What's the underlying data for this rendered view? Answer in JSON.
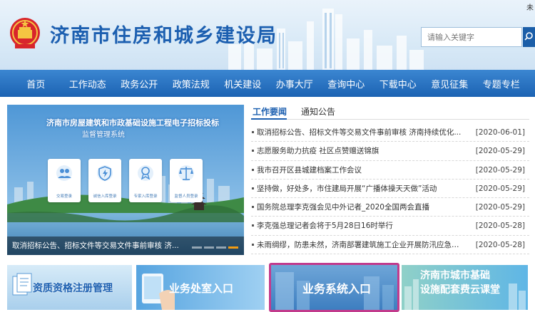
{
  "header": {
    "site_title": "济南市住房和城乡建设局",
    "corner_text": "未",
    "search_placeholder": "请输入关键字",
    "search_icon": "search-icon",
    "colors": {
      "brand_blue": "#1c5fb0",
      "nav_blue": "#2a73c2",
      "highlight_magenta": "#c23b8d"
    }
  },
  "nav": {
    "items": [
      {
        "label": "首页"
      },
      {
        "label": "工作动态"
      },
      {
        "label": "政务公开"
      },
      {
        "label": "政策法规"
      },
      {
        "label": "机关建设"
      },
      {
        "label": "办事大厅"
      },
      {
        "label": "查询中心"
      },
      {
        "label": "下载中心"
      },
      {
        "label": "意见征集"
      },
      {
        "label": "专题专栏"
      }
    ]
  },
  "banner": {
    "title": "济南市房屋建筑和市政基础设施工程电子招标投标",
    "subtitle": "监督管理系统",
    "tiles": [
      {
        "icon": "users-icon",
        "label": "交易登录"
      },
      {
        "icon": "shield-icon",
        "label": "诚信入库登录"
      },
      {
        "icon": "certificate-icon",
        "label": "专家入库登录"
      },
      {
        "icon": "balance-scale-icon",
        "label": "监督人员登录"
      }
    ],
    "caption": "取消招标公告、招标文件等交易文件事前审核 济...",
    "active_slide": 4,
    "slide_count": 4
  },
  "news": {
    "tabs": [
      {
        "label": "工作要闻",
        "active": true
      },
      {
        "label": "通知公告",
        "active": false
      }
    ],
    "items": [
      {
        "title": "取消招标公告、招标文件等交易文件事前审核 济南持续优化...",
        "date": "[2020-06-01]"
      },
      {
        "title": "志愿服务助力抗疫 社区点赞赠送锦旗",
        "date": "[2020-05-29]"
      },
      {
        "title": "我市召开区县城建档案工作会议",
        "date": "[2020-05-29]"
      },
      {
        "title": "坚持做，好处多，市住建局开展“广播体操天天做”活动",
        "date": "[2020-05-29]"
      },
      {
        "title": "国务院总理李克强会见中外记者_2020全国两会直播",
        "date": "[2020-05-29]"
      },
      {
        "title": "李克强总理记者会将于5月28日16时举行",
        "date": "[2020-05-28]"
      },
      {
        "title": "未雨绸缪，防患未然，济南部署建筑施工企业开展防汛应急演...",
        "date": "[2020-05-28]"
      }
    ]
  },
  "quick_links": [
    {
      "label": "资质资格注册管理"
    },
    {
      "label": "业务处室入口"
    },
    {
      "label": "业务系统入口",
      "highlighted": true
    },
    {
      "label": "济南市城市基础",
      "label_line2": "设施配套费云课堂"
    }
  ]
}
